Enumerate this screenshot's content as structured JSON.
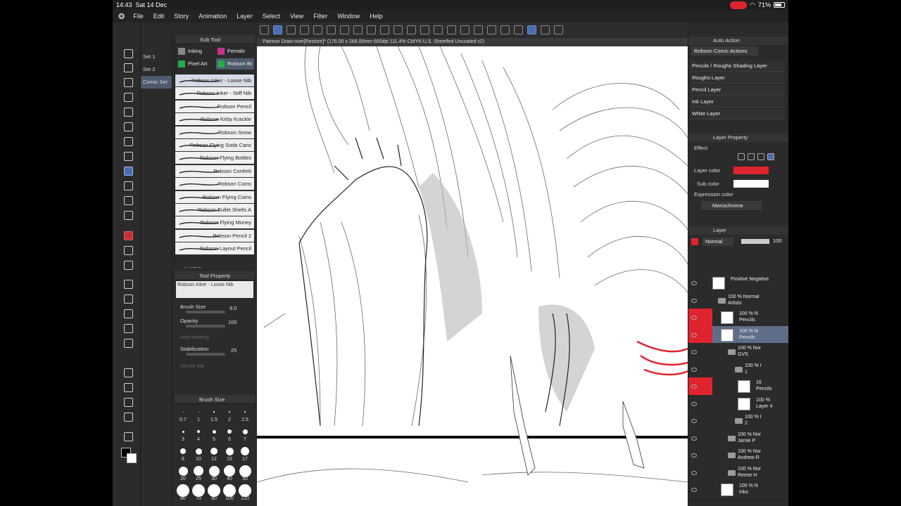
{
  "status": {
    "time": "14:43",
    "date": "Sat 14 Dec",
    "battery": "71%"
  },
  "menu": [
    "File",
    "Edit",
    "Story",
    "Animation",
    "Layer",
    "Select",
    "View",
    "Filter",
    "Window",
    "Help"
  ],
  "sets": [
    "Set 1",
    "Set 2",
    "Comic Set"
  ],
  "commands": [
    {
      "label": "Save",
      "dim": false
    },
    {
      "label": "Und\no",
      "dim": false
    },
    {
      "label": "Redo",
      "dim": true
    },
    {
      "label": "Zoo\nm In",
      "dim": false
    },
    {
      "label": "Zoo\nm Out",
      "dim": false
    },
    {
      "label": "Fit T\no Scre",
      "dim": false
    },
    {
      "label": "Lass\no fill",
      "dim": false
    },
    {
      "label": "Mov\ne layer",
      "dim": false
    },
    {
      "label": "Scal\ne/Rotat",
      "dim": false
    },
    {
      "label": "Free\nTransfor",
      "dim": false
    },
    {
      "label": "Mes\nh Trans",
      "dim": false
    },
    {
      "label": "Flip\nHorizon",
      "dim": false
    },
    {
      "label": "Flip\nVertical",
      "dim": false
    }
  ],
  "subtool": {
    "title": "Sub Tool",
    "tabs": [
      "Inking",
      "Female Fac",
      "Pixel Art",
      "Robson Br"
    ],
    "brushes": [
      "Robson Inker - Loose Nib",
      "Robson Inker - Stiff Nib",
      "Robson Pencil",
      "Robson Kirby Krackle",
      "Robson Snow",
      "Robson Flying Soda Cans",
      "Robson Flying Bottles",
      "Robson Confetti",
      "Robson Coins",
      "Robson Flying Coins",
      "Robson Bullet Shells A",
      "Robson Flying Money",
      "Robson Pencil 2",
      "Robson Layout Pencil"
    ]
  },
  "toolprop": {
    "title": "Tool Property",
    "brush_name": "Robson Inker - Loose Nib",
    "brush_size_label": "Brush Size",
    "brush_size": "9.0",
    "opacity_label": "Opacity",
    "opacity": "100",
    "antialias_label": "Anti-aliasing",
    "stabilization_label": "Stabilization",
    "stabilization": "25",
    "vector_label": "Vector ma"
  },
  "brushsize": {
    "title": "Brush Size",
    "values": [
      "0.7",
      "1",
      "1.5",
      "2",
      "2.5",
      "3",
      "4",
      "5",
      "6",
      "7",
      "8",
      "10",
      "12",
      "15",
      "17",
      "20",
      "25",
      "30",
      "40",
      "50",
      "60",
      "70",
      "80",
      "100",
      "120"
    ]
  },
  "canvas_title": "Patreon Draw-over[Restore]* (176.00 x 266.00mm 600dpi 111.4%  CMYK:U.S. Sheetfed Uncoated v2)",
  "autoaction": {
    "title": "Auto Action",
    "set": "Robson Comic Actions",
    "items": [
      "Pencils / Roughs Shading Layer",
      "Roughs Layer",
      "Pencil Layer",
      "Ink Layer",
      "White Layer"
    ]
  },
  "layerprop": {
    "title": "Layer Property",
    "effect_label": "Effect",
    "layer_color_label": "Layer color",
    "layer_color": "#e0242f",
    "sub_color_label": "Sub color",
    "sub_color": "#ffffff",
    "expr_label": "Expression color",
    "expr_value": "Monochrome"
  },
  "layers": {
    "title": "Layer",
    "blend": "Normal",
    "opacity": "100",
    "items": [
      {
        "text": "Positive Negative",
        "indent": 60,
        "type": "layer",
        "red": false,
        "sel": false
      },
      {
        "text": "100 % Normal\nArtists",
        "indent": 56,
        "type": "folder",
        "red": false,
        "sel": false
      },
      {
        "text": "100 % N\nPencils",
        "indent": 72,
        "type": "layer",
        "red": true,
        "sel": false
      },
      {
        "text": "100 % N\nPencils",
        "indent": 72,
        "type": "layer",
        "red": true,
        "sel": true
      },
      {
        "text": "100 % Nor\nGVS",
        "indent": 70,
        "type": "folder",
        "red": false,
        "sel": false
      },
      {
        "text": "100 % I\n1",
        "indent": 80,
        "type": "folder",
        "red": false,
        "sel": false
      },
      {
        "text": "16\nPencils",
        "indent": 96,
        "type": "layer",
        "red": true,
        "sel": false
      },
      {
        "text": "100 %\nLayer 4",
        "indent": 96,
        "type": "layer",
        "red": false,
        "sel": false
      },
      {
        "text": "100 % I\n2",
        "indent": 80,
        "type": "folder",
        "red": false,
        "sel": false
      },
      {
        "text": "100 % Nor\nJamie P",
        "indent": 70,
        "type": "folder",
        "red": false,
        "sel": false
      },
      {
        "text": "100 % Nor\nAndrew R",
        "indent": 70,
        "type": "folder",
        "red": false,
        "sel": false
      },
      {
        "text": "100 % Nor\nReese H",
        "indent": 70,
        "type": "folder",
        "red": false,
        "sel": false
      },
      {
        "text": "100 % N\nInks",
        "indent": 72,
        "type": "layer",
        "red": false,
        "sel": false
      }
    ]
  }
}
